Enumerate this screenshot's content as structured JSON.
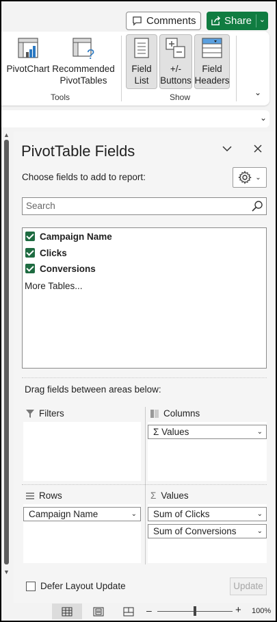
{
  "header": {
    "comments_label": "Comments",
    "share_label": "Share",
    "colors": {
      "share_bg": "#107c41",
      "check_green": "#1e6b41"
    }
  },
  "ribbon": {
    "tools_group": {
      "label": "Tools",
      "items": [
        {
          "label_line1": "PivotChart",
          "label_line2": "",
          "icon": "pivotchart-icon"
        },
        {
          "label_line1": "Recommended",
          "label_line2": "PivotTables",
          "icon": "recommended-pivottables-icon"
        }
      ]
    },
    "show_group": {
      "label": "Show",
      "items": [
        {
          "label_line1": "Field",
          "label_line2": "List",
          "icon": "field-list-icon"
        },
        {
          "label_line1": "+/-",
          "label_line2": "Buttons",
          "icon": "plus-minus-buttons-icon"
        },
        {
          "label_line1": "Field",
          "label_line2": "Headers",
          "icon": "field-headers-icon"
        }
      ]
    }
  },
  "pane": {
    "title": "PivotTable Fields",
    "choose_text": "Choose fields to add to report:",
    "search_placeholder": "Search",
    "fields": [
      {
        "label": "Campaign Name",
        "checked": true
      },
      {
        "label": "Clicks",
        "checked": true
      },
      {
        "label": "Conversions",
        "checked": true
      }
    ],
    "more_tables": "More Tables...",
    "drag_text": "Drag fields between areas below:",
    "areas": {
      "filters": {
        "label": "Filters",
        "items": []
      },
      "columns": {
        "label": "Columns",
        "items": [
          "Values"
        ]
      },
      "rows": {
        "label": "Rows",
        "items": [
          "Campaign Name"
        ]
      },
      "values": {
        "label": "Values",
        "items": [
          "Sum of Clicks",
          "Sum of Conversions"
        ]
      }
    },
    "defer_label": "Defer Layout Update",
    "update_label": "Update"
  },
  "statusbar": {
    "zoom": "100%"
  }
}
